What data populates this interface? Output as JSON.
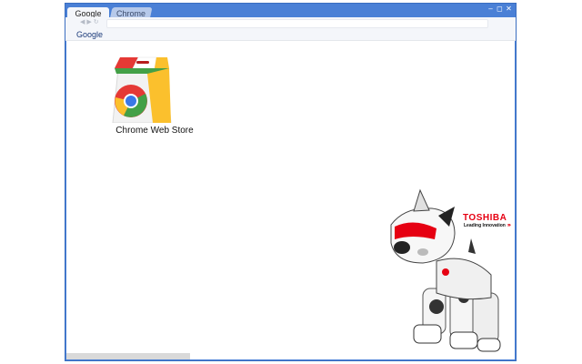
{
  "browser": {
    "tabs": [
      {
        "label": "Google",
        "active": true
      },
      {
        "label": "Chrome",
        "active": false
      }
    ],
    "window_controls": {
      "minimize": "–",
      "maximize": "◻",
      "close": "✕"
    },
    "toolbar": {
      "nav_icons": [
        "back-icon",
        "forward-icon",
        "reload-icon"
      ]
    },
    "bookmarks": [
      {
        "label": "Google"
      }
    ]
  },
  "new_tab": {
    "apps": [
      {
        "label": "Chrome Web Store",
        "icon": "chrome-web-store-icon"
      }
    ]
  },
  "theme_ad": {
    "brand": "TOSHIBA",
    "tagline": "Leading Innovation",
    "tagline_arrows": "›››",
    "image": "robot-dog-illustration"
  },
  "colors": {
    "frame": "#4a80d6",
    "toolbar": "#f4f6fa",
    "brand_red": "#e60012"
  }
}
